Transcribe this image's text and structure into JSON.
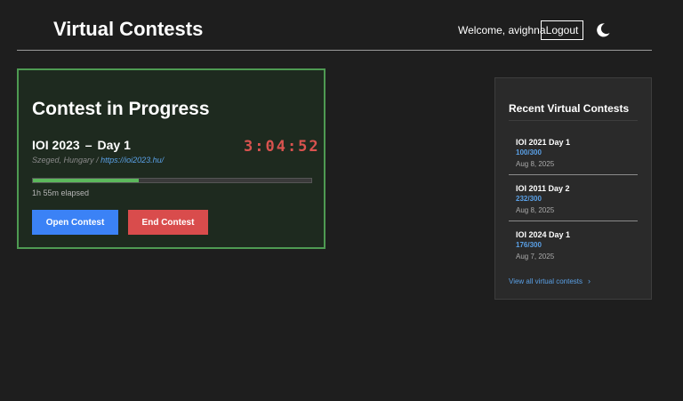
{
  "header": {
    "title": "Virtual Contests",
    "welcome": "Welcome, avighna",
    "logout_label": "Logout",
    "theme_icon": "moon-icon"
  },
  "current_contest": {
    "heading": "Contest in Progress",
    "name": "IOI 2023",
    "separator": "–",
    "day": "Day 1",
    "timer": "3:04:52",
    "location": "Szeged, Hungary",
    "location_sep": "/",
    "url": "https://ioi2023.hu/",
    "progress_fraction": 0.38,
    "elapsed": "1h 55m elapsed",
    "open_label": "Open Contest",
    "end_label": "End Contest"
  },
  "recent": {
    "title": "Recent Virtual Contests",
    "items": [
      {
        "name": "IOI 2021 Day 1",
        "score": "100/300",
        "date": "Aug 8, 2025"
      },
      {
        "name": "IOI 2011 Day 2",
        "score": "232/300",
        "date": "Aug 8, 2025"
      },
      {
        "name": "IOI 2024 Day 1",
        "score": "176/300",
        "date": "Aug 7, 2025"
      }
    ],
    "view_all": "View all virtual contests",
    "view_all_icon": "chevron-right-icon"
  },
  "colors": {
    "background": "#1e1e1e",
    "card_border": "#4e9a52",
    "timer": "#d9534f",
    "progress": "#5cb85c",
    "primary": "#3b82f6",
    "danger": "#d94c4c",
    "link": "#5aa0e6"
  }
}
